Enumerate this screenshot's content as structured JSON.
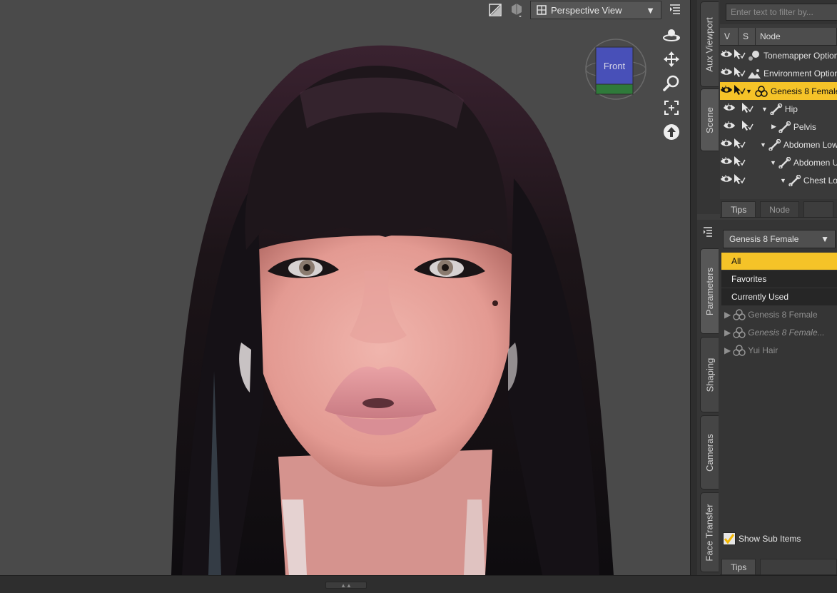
{
  "viewport": {
    "view_label": "Perspective View",
    "cube_label": "Front"
  },
  "side_tabs_top": [
    "Aux Viewport",
    "Scene"
  ],
  "side_tabs_bottom": [
    "Parameters",
    "Shaping",
    "Cameras",
    "Face Transfer"
  ],
  "scene": {
    "search_placeholder": "Enter text to filter by...",
    "col_v": "V",
    "col_s": "S",
    "col_node": "Node",
    "rows": [
      {
        "label": "Tonemapper Options"
      },
      {
        "label": "Environment Options"
      },
      {
        "label": "Genesis 8 Female"
      },
      {
        "label": "Hip"
      },
      {
        "label": "Pelvis"
      },
      {
        "label": "Abdomen Lower"
      },
      {
        "label": "Abdomen Upper"
      },
      {
        "label": "Chest Lower"
      }
    ],
    "tabs": [
      "Tips",
      "Node"
    ]
  },
  "parameters": {
    "node_select": "Genesis 8 Female",
    "filters": [
      "All",
      "Favorites",
      "Currently Used"
    ],
    "tree": [
      {
        "label": "Genesis 8 Female"
      },
      {
        "label": "Genesis 8 Female..."
      },
      {
        "label": "Yui Hair"
      }
    ],
    "show_sub_items": "Show Sub Items",
    "tabs": [
      "Tips"
    ]
  },
  "colors": {
    "selection": "#f5c328",
    "background": "#3c3c3c"
  }
}
